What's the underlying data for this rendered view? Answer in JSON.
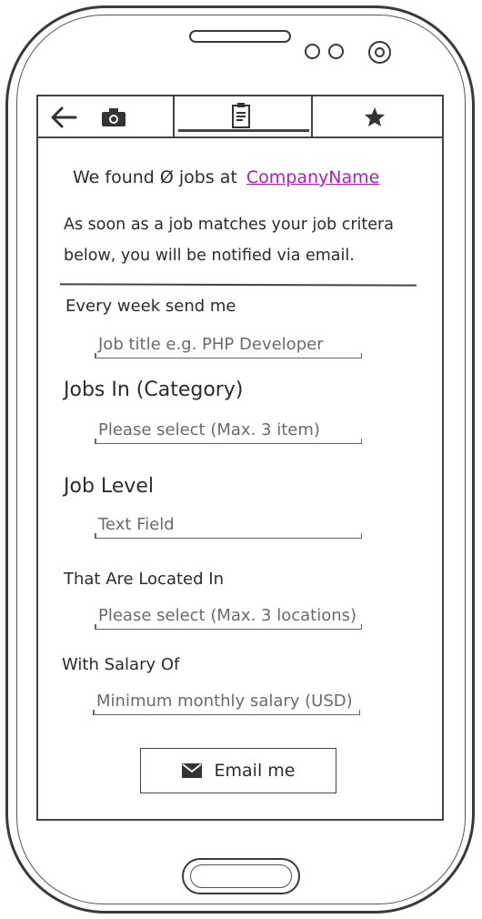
{
  "header": {
    "found_text": "We found Ø jobs at",
    "company_link": "CompanyName",
    "info_text": "As soon as a job matches your job critera below, you will be notified via email."
  },
  "tabs": [
    {
      "icon": "back-arrow-icon"
    },
    {
      "icon": "camera-icon"
    },
    {
      "icon": "clipboard-icon",
      "active": true
    },
    {
      "icon": "star-icon"
    }
  ],
  "form": {
    "every_week_label": "Every week send me",
    "job_title_placeholder": "Job title e.g. PHP Developer",
    "category_label": "Jobs In (Category)",
    "category_placeholder": "Please select (Max. 3 item)",
    "level_label": "Job Level",
    "level_placeholder": "Text Field",
    "location_label": "That Are Located In",
    "location_placeholder": "Please select (Max. 3 locations)",
    "salary_label": "With Salary Of",
    "salary_placeholder": "Minimum monthly salary (USD)"
  },
  "button": {
    "email_label": "Email me",
    "icon": "envelope-icon"
  },
  "colors": {
    "link": "#b21cb7",
    "ink": "#2b2b2b",
    "placeholder": "#6b6b6b"
  }
}
